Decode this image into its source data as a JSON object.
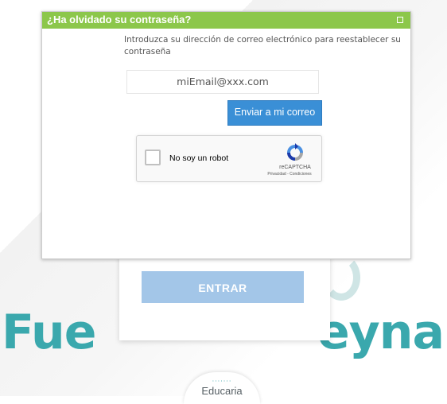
{
  "dialog": {
    "title": "¿Ha olvidado su contraseña?",
    "instructions": "Introduzca su dirección de correo electrónico para reestablecer su contraseña",
    "email_value": "miEmail@xxx.com",
    "send_button": "Enviar a mi correo"
  },
  "recaptcha": {
    "label": "No soy un robot",
    "brand": "reCAPTCHA",
    "links": "Privacidad - Condiciones"
  },
  "login": {
    "enter_button": "ENTRAR"
  },
  "branding": {
    "left_text": "Fue",
    "right_text": "eyna",
    "educaria_dots": "·······",
    "educaria": "Educaria"
  },
  "colors": {
    "header": "#8cc74b",
    "send_button": "#3a8fd6",
    "enter_button": "#a3c6e8",
    "brand": "#3aa8ad"
  }
}
